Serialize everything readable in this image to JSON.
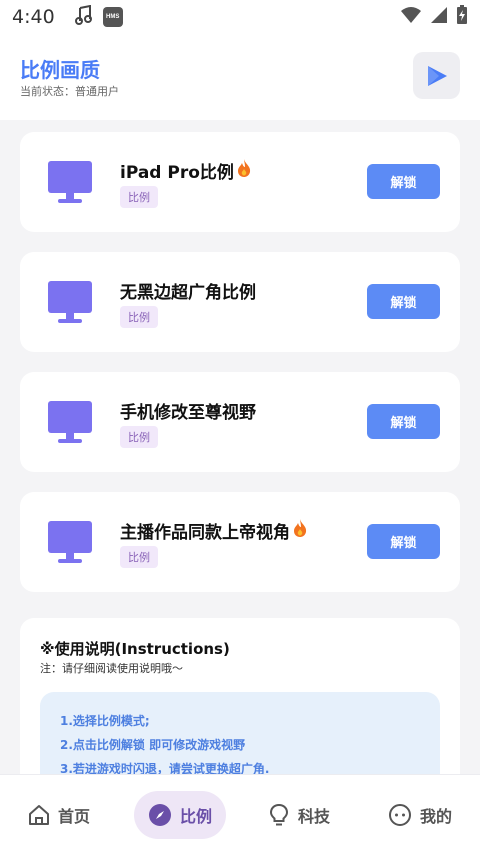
{
  "status_bar": {
    "time": "4:40",
    "badge": "HMS"
  },
  "header": {
    "title": "比例画质",
    "status": "当前状态：普通用户"
  },
  "cards": [
    {
      "name": "iPad Pro比例",
      "fire": true,
      "tag": "比例",
      "button": "解锁"
    },
    {
      "name": "无黑边超广角比例",
      "fire": false,
      "tag": "比例",
      "button": "解锁"
    },
    {
      "name": "手机修改至尊视野",
      "fire": false,
      "tag": "比例",
      "button": "解锁"
    },
    {
      "name": "主播作品同款上帝视角",
      "fire": true,
      "tag": "比例",
      "button": "解锁"
    }
  ],
  "instructions": {
    "title": "※使用说明(Instructions)",
    "note": "注：请仔细阅读使用说明哦～",
    "steps": [
      "1.选择比例模式;",
      "2.点击比例解锁 即可修改游戏视野",
      "3.若进游戏时闪退，请尝试更换超广角."
    ]
  },
  "nav": [
    {
      "label": "首页",
      "icon": "home-icon"
    },
    {
      "label": "比例",
      "icon": "compass-icon",
      "active": true
    },
    {
      "label": "科技",
      "icon": "lightbulb-icon"
    },
    {
      "label": "我的",
      "icon": "smiley-icon"
    }
  ],
  "colors": {
    "accent": "#4a7cf6",
    "button": "#5c8bf5",
    "monitor": "#7b72f0",
    "tag_bg": "#f1e8fa",
    "tag_text": "#8a63b8",
    "nav_active_bg": "#eee6f6"
  }
}
